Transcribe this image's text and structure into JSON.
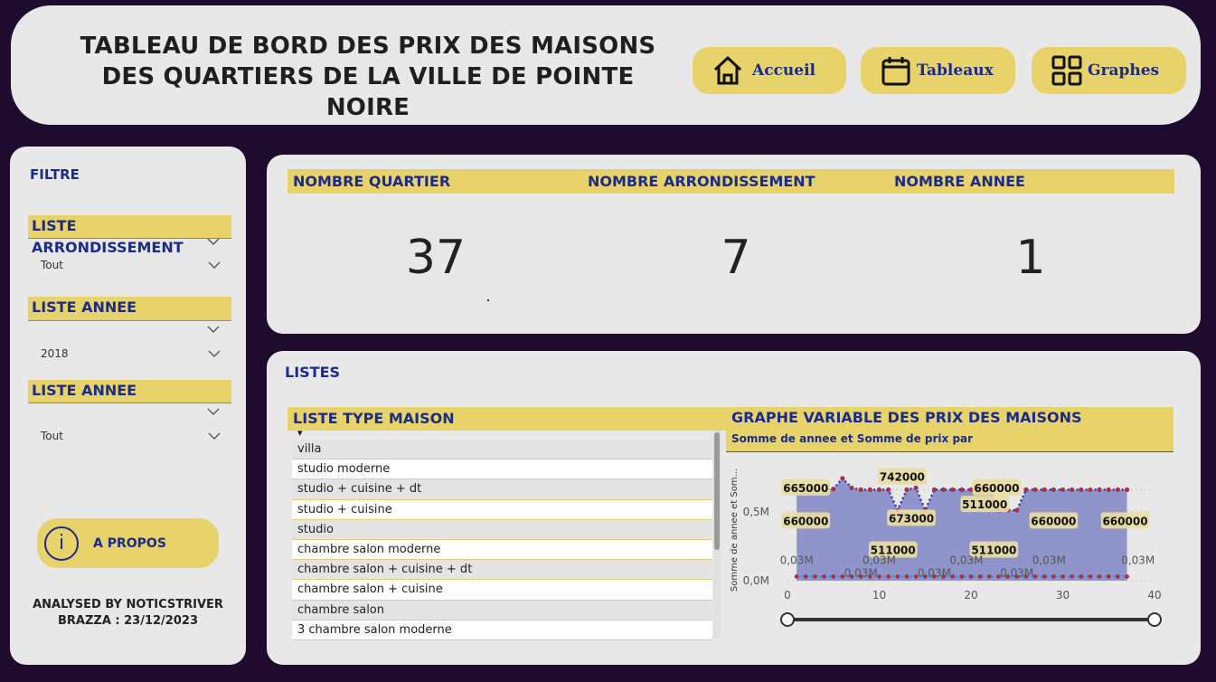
{
  "header": {
    "title": "TABLEAU DE BORD DES PRIX DES MAISONS DES QUARTIERS DE LA VILLE DE POINTE NOIRE",
    "nav": [
      {
        "label": "Accueil",
        "icon": "home-icon"
      },
      {
        "label": "Tableaux",
        "icon": "calendar-icon"
      },
      {
        "label": "Graphes",
        "icon": "grid-icon"
      }
    ]
  },
  "filter": {
    "title": "FILTRE",
    "slicers": [
      {
        "label": "LISTE ARRONDISSEMENT",
        "value": "Tout"
      },
      {
        "label": "LISTE ANNEE",
        "value": "2018"
      },
      {
        "label": "LISTE ANNEE",
        "value": "Tout"
      }
    ],
    "apropos": {
      "icon_glyph": "i",
      "label": "A PROPOS"
    },
    "analysed_line1": "ANALYSED BY NOTICSTRIVER",
    "analysed_line2": "BRAZZA : 23/12/2023"
  },
  "kpis": [
    {
      "label": "NOMBRE QUARTIER",
      "value": "37"
    },
    {
      "label": "NOMBRE ARRONDISSEMENT",
      "value": "7"
    },
    {
      "label": "NOMBRE ANNEE",
      "value": "1"
    }
  ],
  "listes": {
    "title": "LISTES",
    "type_maison_header": "LISTE TYPE MAISON",
    "sort_glyph": "▾",
    "items": [
      "villa",
      "studio moderne",
      "studio + cuisine + dt",
      "studio + cuisine",
      "studio",
      "chambre salon moderne",
      "chambre salon + cuisine + dt",
      "chambre salon + cuisine",
      "chambre salon",
      "3 chambre salon moderne"
    ]
  },
  "chart_data": {
    "type": "line",
    "title": "GRAPHE VARIABLE DES PRIX DES MAISONS",
    "subtitle": "Somme de annee et Somme de prix par",
    "ylabel": "Somme de annee et Som...",
    "xlim": [
      0,
      40
    ],
    "ylim": [
      0,
      0.8
    ],
    "x_ticks": [
      "0",
      "10",
      "20",
      "30",
      "40"
    ],
    "y_ticks": [
      "0,0M",
      "0,5M"
    ],
    "accent_colors": {
      "prix": "#2a3aa8",
      "annee": "#4a90e2",
      "points": "#b03040",
      "area": "#8a90c8"
    },
    "series": [
      {
        "name": "Somme de prix",
        "x": [
          1,
          2,
          3,
          4,
          5,
          6,
          7,
          8,
          9,
          10,
          11,
          12,
          13,
          14,
          15,
          16,
          17,
          18,
          19,
          20,
          21,
          22,
          23,
          24,
          25,
          26,
          27,
          28,
          29,
          30,
          31,
          32,
          33,
          34,
          35,
          36,
          37
        ],
        "values": [
          0.66,
          0.66,
          0.66,
          0.66,
          0.665,
          0.742,
          0.673,
          0.66,
          0.66,
          0.66,
          0.66,
          0.511,
          0.66,
          0.673,
          0.511,
          0.66,
          0.66,
          0.66,
          0.66,
          0.66,
          0.66,
          0.66,
          0.511,
          0.511,
          0.511,
          0.66,
          0.66,
          0.66,
          0.66,
          0.66,
          0.66,
          0.66,
          0.66,
          0.66,
          0.66,
          0.66,
          0.66
        ]
      },
      {
        "name": "Somme de annee",
        "x": [
          1,
          2,
          3,
          4,
          5,
          6,
          7,
          8,
          9,
          10,
          11,
          12,
          13,
          14,
          15,
          16,
          17,
          18,
          19,
          20,
          21,
          22,
          23,
          24,
          25,
          26,
          27,
          28,
          29,
          30,
          31,
          32,
          33,
          34,
          35,
          36,
          37
        ],
        "values": [
          0.03,
          0.03,
          0.03,
          0.03,
          0.03,
          0.03,
          0.03,
          0.03,
          0.03,
          0.03,
          0.03,
          0.03,
          0.03,
          0.03,
          0.03,
          0.03,
          0.03,
          0.03,
          0.03,
          0.03,
          0.03,
          0.03,
          0.03,
          0.03,
          0.03,
          0.03,
          0.03,
          0.03,
          0.03,
          0.03,
          0.03,
          0.03,
          0.03,
          0.03,
          0.03,
          0.03,
          0.03
        ]
      }
    ],
    "data_labels": [
      "665000",
      "742000",
      "660000",
      "511000",
      "660000",
      "673000",
      "511000",
      "511000",
      "660000",
      "660000",
      "0,03M",
      "0,03M",
      "0,03M",
      "0,03M",
      "0,03M",
      "0,03M",
      "0,03M",
      "0,03M"
    ]
  }
}
